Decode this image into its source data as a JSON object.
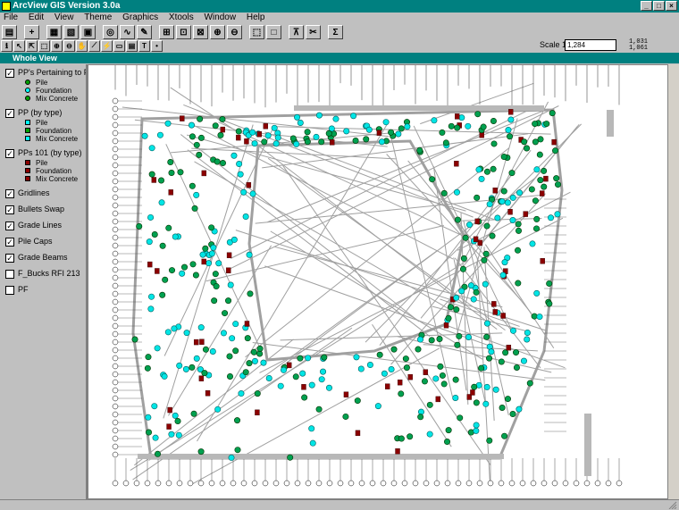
{
  "app": {
    "title": "ArcView GIS Version 3.0a"
  },
  "menu": [
    "File",
    "Edit",
    "View",
    "Theme",
    "Graphics",
    "Xtools",
    "Window",
    "Help"
  ],
  "toolbar": {
    "scale_label": "Scale 1:",
    "scale_value": "1,284",
    "coords_line1": "1,031",
    "coords_line2": "1,061"
  },
  "view": {
    "title": "Whole View"
  },
  "toc": {
    "themes": [
      {
        "label": "PP's Pertaining to F",
        "checked": true,
        "legend": [
          {
            "label": "Pile",
            "color": "#00a000"
          },
          {
            "label": "Foundation",
            "color": "#00ffff"
          },
          {
            "label": "Mix Concrete",
            "color": "#00a000"
          }
        ]
      },
      {
        "label": "PP (by type)",
        "checked": true,
        "legend": [
          {
            "label": "Pile",
            "color": "#00ffff"
          },
          {
            "label": "Foundation",
            "color": "#00a000"
          },
          {
            "label": "Mix Concrete",
            "color": "#00ffff"
          }
        ]
      },
      {
        "label": "PPs 101 (by type)",
        "checked": true,
        "legend": [
          {
            "label": "Pile",
            "color": "#8b0000"
          },
          {
            "label": "Foundation",
            "color": "#8b0000"
          },
          {
            "label": "Mix Concrete",
            "color": "#8b0000"
          }
        ]
      },
      {
        "label": "Gridlines",
        "checked": true,
        "legend": []
      },
      {
        "label": "Bullets Swap",
        "checked": true,
        "legend": []
      },
      {
        "label": "Grade Lines",
        "checked": true,
        "legend": []
      },
      {
        "label": "Pile Caps",
        "checked": true,
        "legend": []
      },
      {
        "label": "Grade Beams",
        "checked": true,
        "legend": []
      },
      {
        "label": "F_Bucks RFI 213",
        "checked": false,
        "legend": []
      },
      {
        "label": "PF",
        "checked": false,
        "legend": []
      }
    ]
  },
  "map": {
    "colors": {
      "pile": "#00a050",
      "cyan": "#00e5e5",
      "red": "#8b0000",
      "lines": "#a0a0a0",
      "dark": "#505050"
    }
  }
}
